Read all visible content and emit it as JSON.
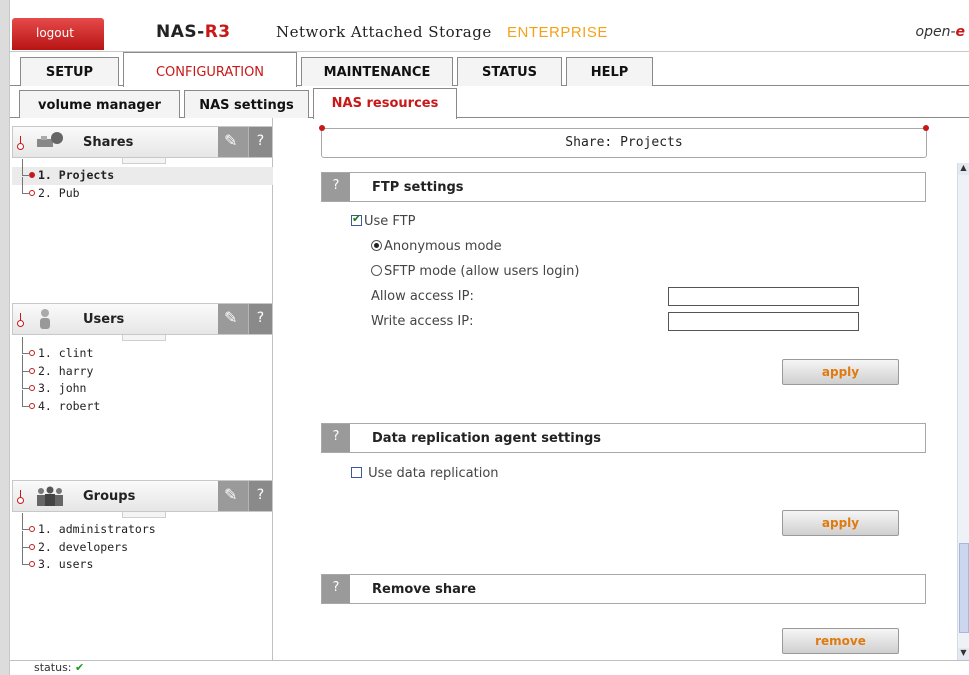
{
  "header": {
    "logout_label": "logout",
    "brand_main": "NAS-",
    "brand_accent": "R3",
    "subtitle": "Network Attached Storage",
    "edition": "ENTERPRISE",
    "vendor_prefix": "open-",
    "vendor_suffix": "e"
  },
  "main_tabs": [
    {
      "label": "SETUP"
    },
    {
      "label": "CONFIGURATION",
      "active": true
    },
    {
      "label": "MAINTENANCE"
    },
    {
      "label": "STATUS"
    },
    {
      "label": "HELP"
    }
  ],
  "sub_tabs": [
    {
      "label": "volume manager"
    },
    {
      "label": "NAS settings"
    },
    {
      "label": "NAS resources",
      "active": true
    }
  ],
  "sidebar": {
    "shares": {
      "title": "Shares",
      "icon": "shares-icon",
      "items": [
        "1. Projects",
        "2. Pub"
      ],
      "selected_index": 0
    },
    "users": {
      "title": "Users",
      "icon": "user-icon",
      "items": [
        "1. clint",
        "2. harry",
        "3. john",
        "4. robert"
      ]
    },
    "groups": {
      "title": "Groups",
      "icon": "group-icon",
      "items": [
        "1. administrators",
        "2. developers",
        "3. users"
      ]
    },
    "tool_icon": "wrench-icon",
    "help_label": "?"
  },
  "main": {
    "share_title": "Share: Projects",
    "ftp": {
      "title": "FTP settings",
      "help_label": "?",
      "use_ftp_label": "Use FTP",
      "use_ftp_checked": true,
      "anonymous_label": "Anonymous mode",
      "anonymous_selected": true,
      "sftp_label": "SFTP mode (allow users login)",
      "sftp_selected": false,
      "allow_ip_label": "Allow access IP:",
      "allow_ip_value": "",
      "write_ip_label": "Write access IP:",
      "write_ip_value": "",
      "apply_label": "apply"
    },
    "replication": {
      "title": "Data replication agent settings",
      "help_label": "?",
      "use_label": "Use data replication",
      "use_checked": false,
      "apply_label": "apply"
    },
    "remove": {
      "title": "Remove share",
      "help_label": "?",
      "remove_label": "remove"
    }
  },
  "statusbar": {
    "label": "status:",
    "ok_icon": "check-icon",
    "ok_glyph": "✔"
  },
  "colors": {
    "accent_red": "#c81818",
    "edition_orange": "#f5a21b",
    "button_text": "#e07a10"
  }
}
